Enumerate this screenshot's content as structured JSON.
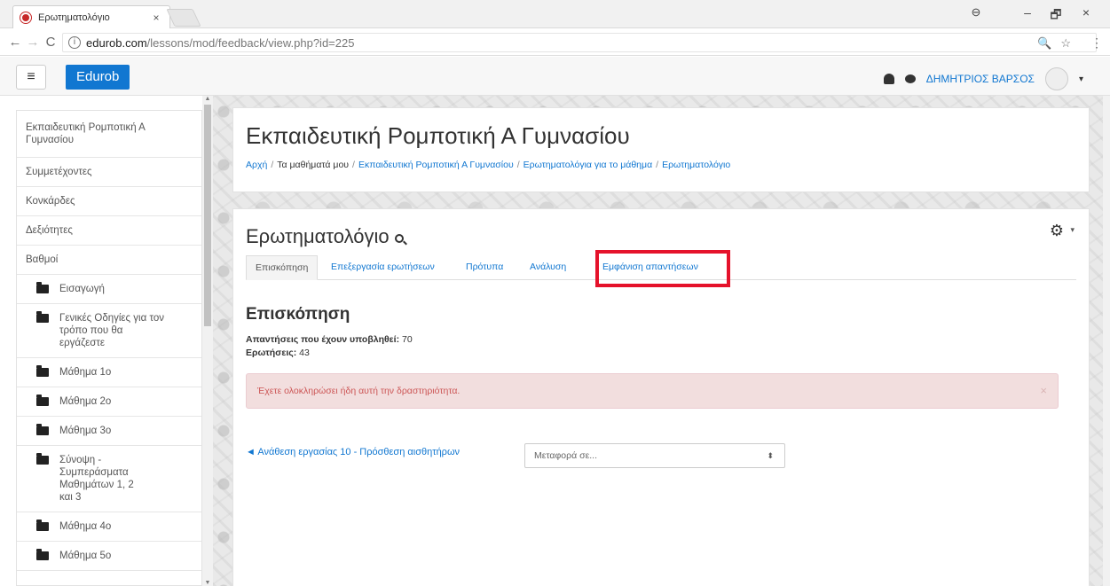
{
  "browser": {
    "tab_title": "Ερωτηματολόγιο",
    "tab_close": "×",
    "win_min": "–",
    "win_max": "🗗",
    "win_close": "×",
    "back": "←",
    "forward": "→",
    "reload": "C",
    "url_host": "edurob.com",
    "url_path": "/lessons/mod/feedback/view.php?id=225",
    "zoom_icon": "🔍",
    "star_icon": "☆",
    "menu_icon": "⋮"
  },
  "navbar": {
    "drawer_icon": "≡",
    "brand": "Edurob",
    "user_name": "ΔΗΜΗΤΡΙΟΣ ΒΑΡΣΟΣ",
    "caret": "▾"
  },
  "sidebar": {
    "items": [
      {
        "label": "Εκπαιδευτική Ρομποτική Α Γυμνασίου"
      },
      {
        "label": "Συμμετέχοντες"
      },
      {
        "label": "Κονκάρδες"
      },
      {
        "label": "Δεξιότητες"
      },
      {
        "label": "Βαθμοί"
      }
    ],
    "folders": [
      {
        "label": "Εισαγωγή"
      },
      {
        "label": "Γενικές Οδηγίες για τον τρόπο που θα εργάζεστε"
      },
      {
        "label": "Μάθημα 1ο"
      },
      {
        "label": "Μάθημα 2ο"
      },
      {
        "label": "Μάθημα 3ο"
      },
      {
        "label": "Σύνοψη - Συμπεράσματα Μαθημάτων 1, 2 και 3"
      },
      {
        "label": "Μάθημα 4ο"
      },
      {
        "label": "Μάθημα 5ο"
      }
    ]
  },
  "header": {
    "course_title": "Εκπαιδευτική Ρομποτική Α Γυμνασίου",
    "breadcrumb": [
      {
        "label": "Αρχή"
      },
      {
        "label": "Τα μαθήματά μου"
      },
      {
        "label": "Εκπαιδευτική Ρομποτική Α Γυμνασίου"
      },
      {
        "label": "Ερωτηματολόγια για το μάθημα"
      },
      {
        "label": "Ερωτηματολόγιο"
      }
    ],
    "separator": "/"
  },
  "main": {
    "page_title": "Ερωτηματολόγιο",
    "gear_icon": "⚙",
    "gear_caret": "▾",
    "tabs": [
      {
        "label": "Επισκόπηση"
      },
      {
        "label": "Επεξεργασία ερωτήσεων"
      },
      {
        "label": "Πρότυπα"
      },
      {
        "label": "Ανάλυση"
      },
      {
        "label": "Εμφάνιση απαντήσεων"
      }
    ],
    "section_title": "Επισκόπηση",
    "responses_label": "Απαντήσεις που έχουν υποβληθεί:",
    "responses_value": "70",
    "questions_label": "Ερωτήσεις:",
    "questions_value": "43",
    "alert_text": "Έχετε ολοκληρώσει ήδη αυτή την δραστηριότητα.",
    "alert_close": "×",
    "prev_link": "◄ Ανάθεση εργασίας 10 - Πρόσθεση αισθητήρων",
    "jump_placeholder": "Μεταφορά σε...",
    "jump_arrow": "⬍"
  }
}
